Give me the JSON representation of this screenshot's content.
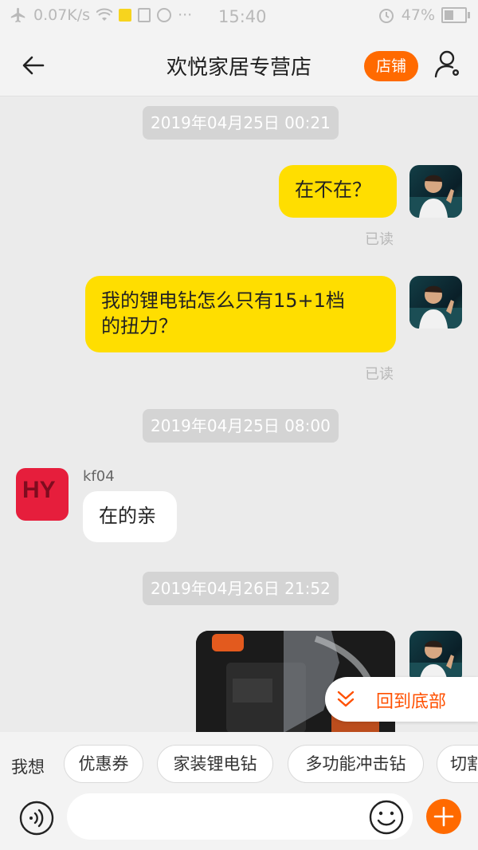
{
  "status_bar": {
    "speed": "0.07K/s",
    "time": "15:40",
    "battery": "47%",
    "more": "···"
  },
  "header": {
    "title": "欢悦家居专营店",
    "shop_button": "店铺"
  },
  "messages": {
    "ts1": "2019年04月25日 00:21",
    "msg1": "在不在？",
    "read1": "已读",
    "msg2_line1": "我的锂电钻怎么只有15+1档",
    "msg2_line2": "的扭力？",
    "read2": "已读",
    "ts2": "2019年04月25日 08:00",
    "sender": "kf04",
    "shop_logo": "HY",
    "msg3": "在的亲",
    "ts3": "2019年04月26日 21:52"
  },
  "back_to_bottom": "回到底部",
  "suggestions": {
    "label": "我想",
    "chips": [
      "优惠券",
      "家装锂电钻",
      "多功能冲击钻",
      "切割"
    ]
  },
  "input": {
    "placeholder": ""
  },
  "colors": {
    "accent": "#ff6a00",
    "my_bubble": "#ffde00"
  }
}
